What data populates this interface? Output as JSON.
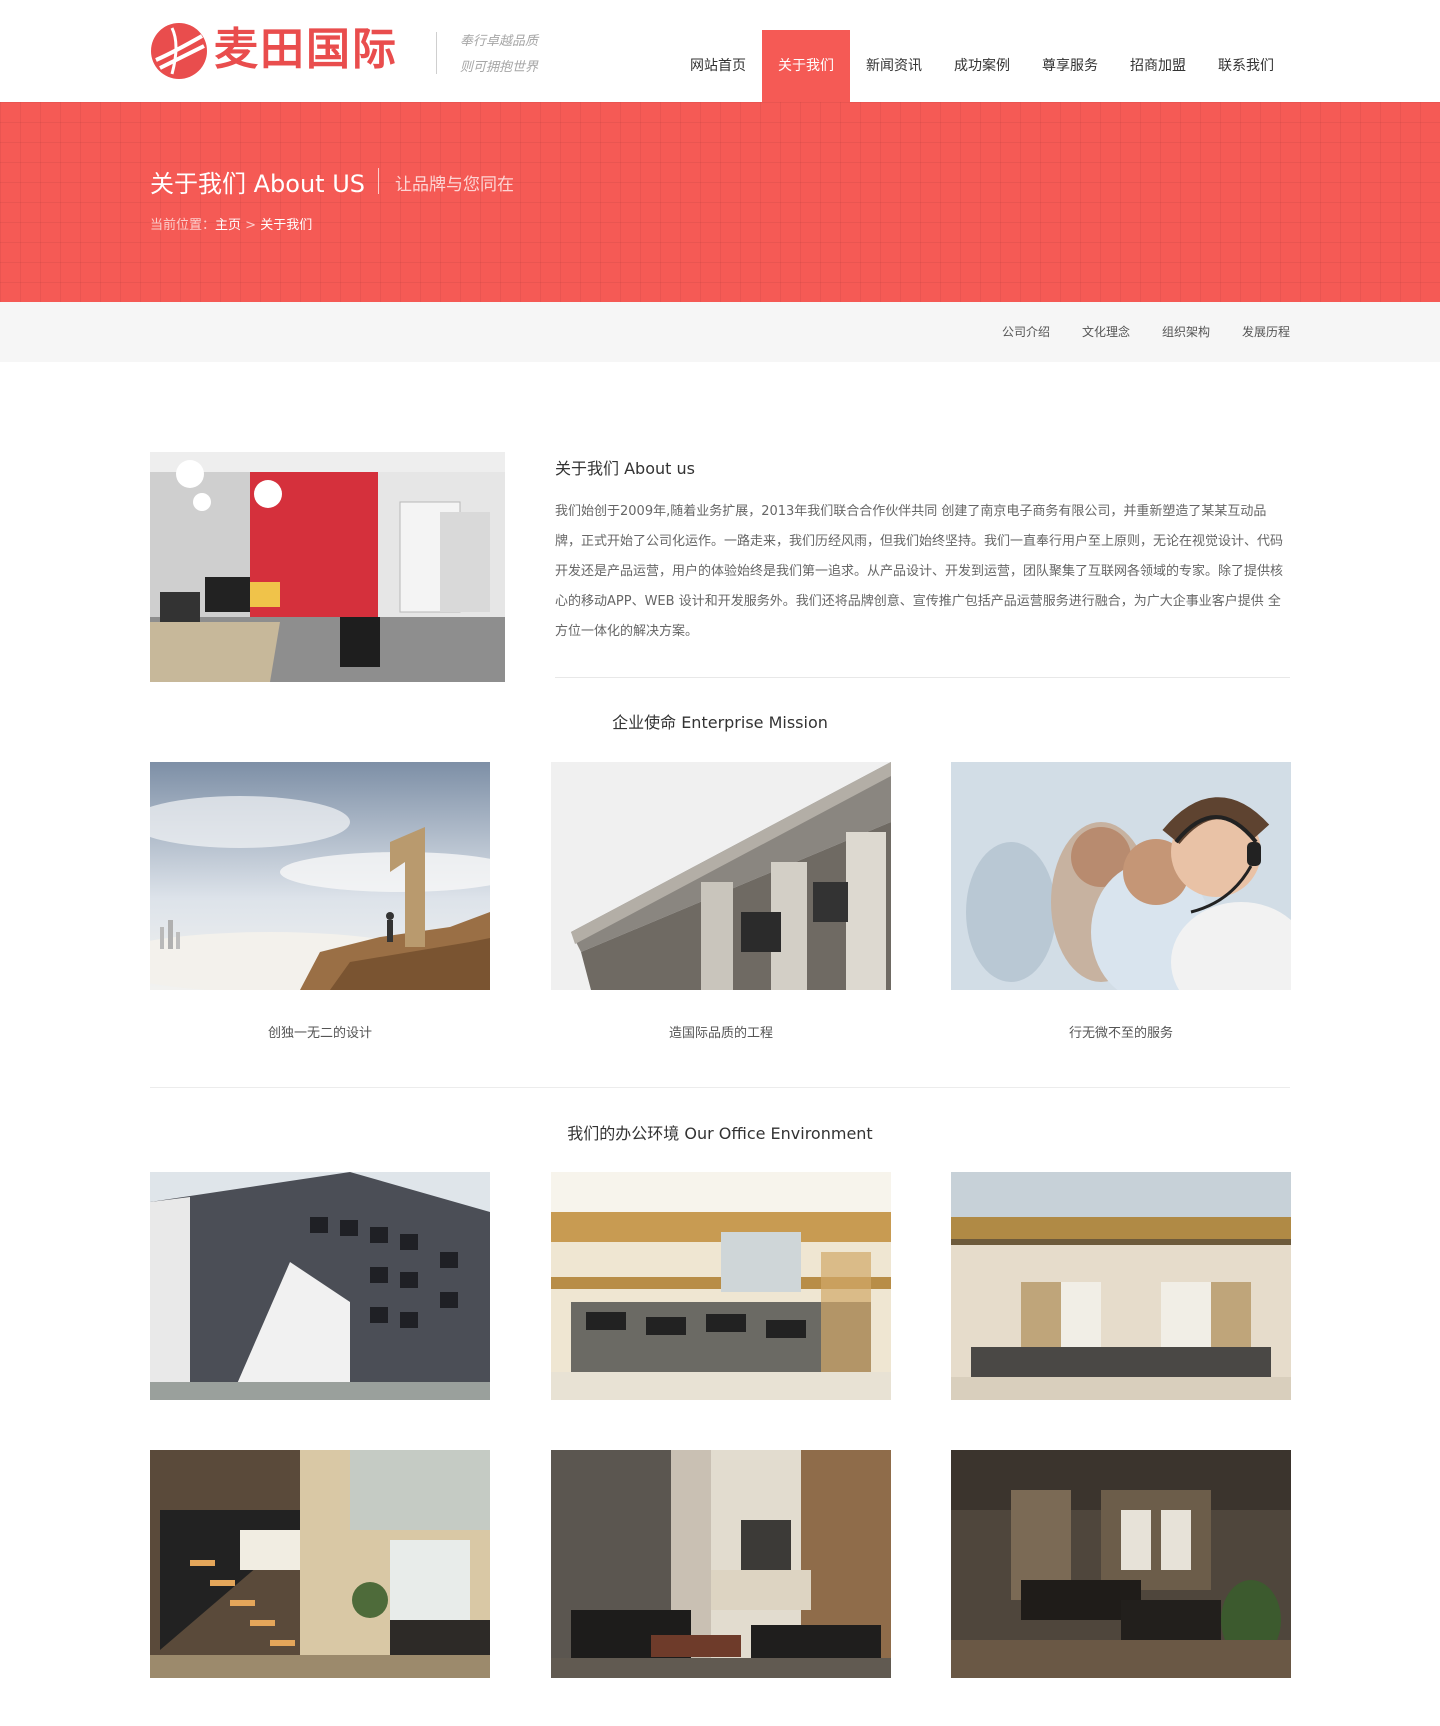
{
  "header": {
    "brand": "麦田国际",
    "slogan_line1": "奉行卓越品质",
    "slogan_line2": "则可拥抱世界",
    "nav": [
      {
        "label": "网站首页"
      },
      {
        "label": "关于我们"
      },
      {
        "label": "新闻资讯"
      },
      {
        "label": "成功案例"
      },
      {
        "label": "尊享服务"
      },
      {
        "label": "招商加盟"
      },
      {
        "label": "联系我们"
      }
    ]
  },
  "banner": {
    "title": "关于我们 About US",
    "subtitle": "让品牌与您同在",
    "breadcrumb_prefix": "当前位置：",
    "breadcrumb_home": "主页",
    "breadcrumb_sep": " > ",
    "breadcrumb_current": "关于我们"
  },
  "subnav": [
    {
      "label": "公司介绍"
    },
    {
      "label": "文化理念"
    },
    {
      "label": "组织架构"
    },
    {
      "label": "发展历程"
    }
  ],
  "about": {
    "title": "关于我们 About us",
    "text": "我们始创于2009年,随着业务扩展，2013年我们联合合作伙伴共同 创建了南京电子商务有限公司，并重新塑造了某某互动品牌，正式开始了公司化运作。一路走来，我们历经风雨，但我们始终坚持。我们一直奉行用户至上原则，无论在视觉设计、代码开发还是产品运营，用户的体验始终是我们第一追求。从产品设计、开发到运营，团队聚集了互联网各领域的专家。除了提供核心的移动APP、WEB 设计和开发服务外。我们还将品牌创意、宣传推广包括产品运营服务进行融合，为广大企事业客户提供 全方位一体化的解决方案。"
  },
  "mission": {
    "title": "企业使命 Enterprise Mission",
    "items": [
      {
        "caption": "创独一无二的设计"
      },
      {
        "caption": "造国际品质的工程"
      },
      {
        "caption": "行无微不至的服务"
      }
    ]
  },
  "office": {
    "title": "我们的办公环境 Our Office Environment"
  },
  "colors": {
    "accent": "#f55a55",
    "brand_text": "#e94d4d"
  }
}
